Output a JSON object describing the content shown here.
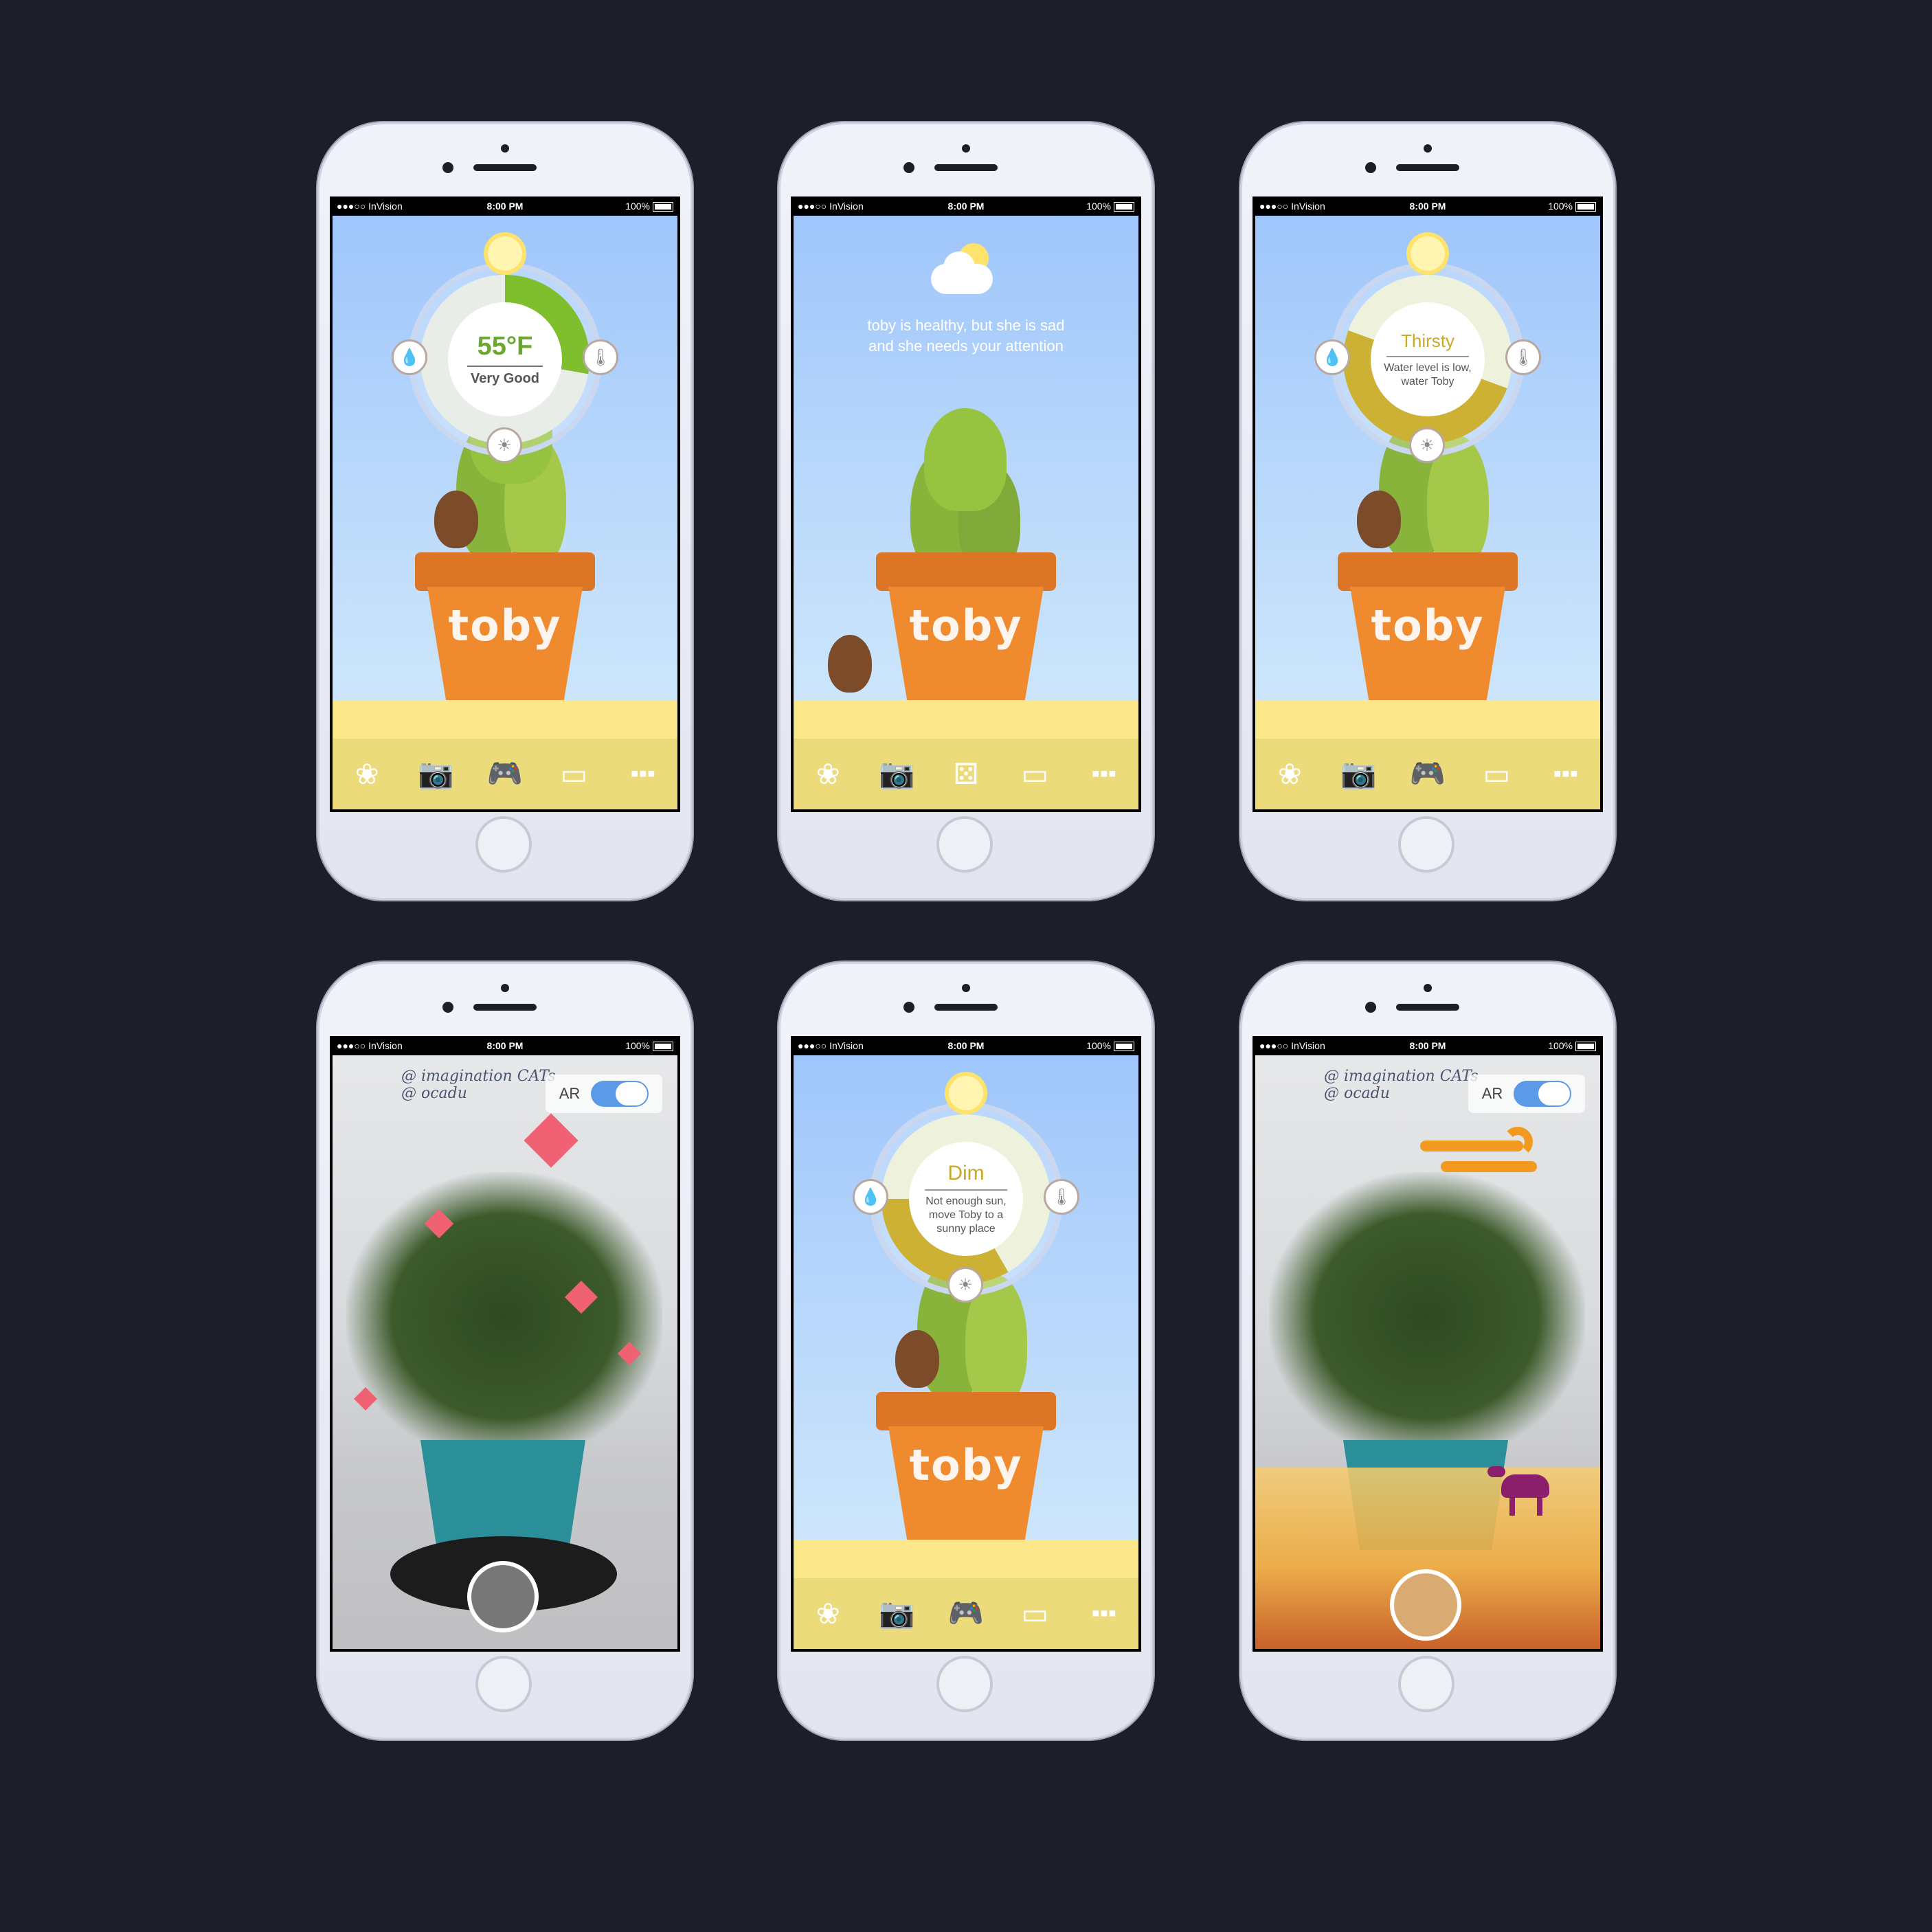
{
  "status": {
    "carrier": "●●●○○ InVision",
    "time": "8:00 PM",
    "battery": "100%"
  },
  "plant_name": "toby",
  "tabs": [
    "plant",
    "camera",
    "game",
    "notes",
    "more"
  ],
  "screen1": {
    "temperature": "55°F",
    "condition": "Very Good"
  },
  "screen2": {
    "message": "toby is healthy, but she is sad and she needs your attention"
  },
  "screen3": {
    "state": "Thirsty",
    "detail": "Water level is low, water Toby"
  },
  "screen4": {
    "ar_label": "AR",
    "whiteboard_text": "@ imagination CATs @ ocadu"
  },
  "screen5": {
    "state": "Dim",
    "detail": "Not enough sun, move Toby to a sunny place"
  },
  "screen6": {
    "ar_label": "AR",
    "whiteboard_text": "@ imagination CATs @ ocadu"
  },
  "colors": {
    "sky": "#9fc6fb",
    "ground": "#fbe88b",
    "tabbar": "#ecdb7a",
    "pot": "#f08a2e",
    "leaf": "#8bbd3c",
    "good": "#6aa82e",
    "warn": "#c9a928"
  }
}
